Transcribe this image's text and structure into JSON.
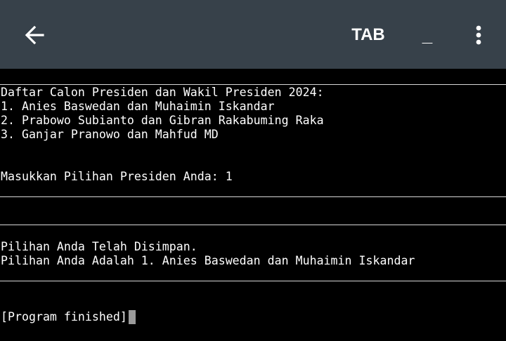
{
  "toolbar": {
    "back_icon": "arrow-left-icon",
    "tab_label": "TAB",
    "underscore_label": "_",
    "more_icon": "more-vertical-icon",
    "background": "#37414a"
  },
  "console": {
    "candidates_header": "Daftar Calon Presiden dan Wakil Presiden 2024:",
    "candidates": [
      "1. Anies Baswedan dan Muhaimin Iskandar",
      "2. Prabowo Subianto dan Gibran Rakabuming Raka",
      "3. Ganjar Pranowo dan Mahfud MD"
    ],
    "input_prompt": "Masukkan Pilihan Presiden Anda: 1",
    "saved_message": "Pilihan Anda Telah Disimpan.",
    "choice_message": "Pilihan Anda Adalah 1. Anies Baswedan dan Muhaimin Iskandar",
    "finished": "[Program finished]"
  }
}
